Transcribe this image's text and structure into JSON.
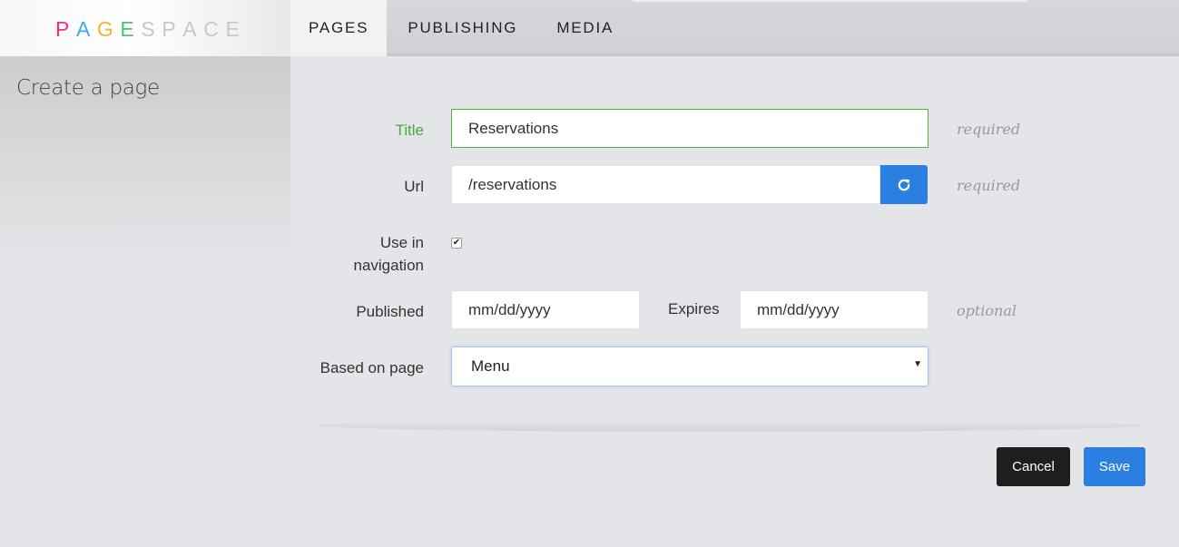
{
  "header": {
    "logo_letters": [
      {
        "char": "P",
        "color": "#e8317a"
      },
      {
        "char": "A",
        "color": "#3ea8e6"
      },
      {
        "char": "G",
        "color": "#f0b52c"
      },
      {
        "char": "E",
        "color": "#4cc46a"
      },
      {
        "char": "S",
        "color": "#c8c8c8"
      },
      {
        "char": "P",
        "color": "#c8c8c8"
      },
      {
        "char": "A",
        "color": "#c8c8c8"
      },
      {
        "char": "C",
        "color": "#c8c8c8"
      },
      {
        "char": "E",
        "color": "#c8c8c8"
      }
    ],
    "nav": [
      "PAGES",
      "PUBLISHING",
      "MEDIA"
    ],
    "active_nav": "PAGES"
  },
  "sidebar": {
    "title": "Create a page"
  },
  "form": {
    "title_label": "Title",
    "title_value": "Reservations",
    "title_hint": "required",
    "url_label": "Url",
    "url_value": "/reservations",
    "url_hint": "required",
    "refresh_icon": "refresh-icon",
    "nav_label_line1": "Use in",
    "nav_label_line2": "navigation",
    "nav_checked": true,
    "published_label": "Published",
    "published_placeholder": "mm/dd/yyyy",
    "expires_label": "Expires",
    "expires_placeholder": "mm/dd/yyyy",
    "dates_hint": "optional",
    "based_on_label": "Based on page",
    "based_on_value": "Menu"
  },
  "actions": {
    "cancel": "Cancel",
    "save": "Save"
  },
  "colors": {
    "accent": "#2b7fe0",
    "valid": "#4caa2e",
    "dark": "#1e1e1e"
  }
}
